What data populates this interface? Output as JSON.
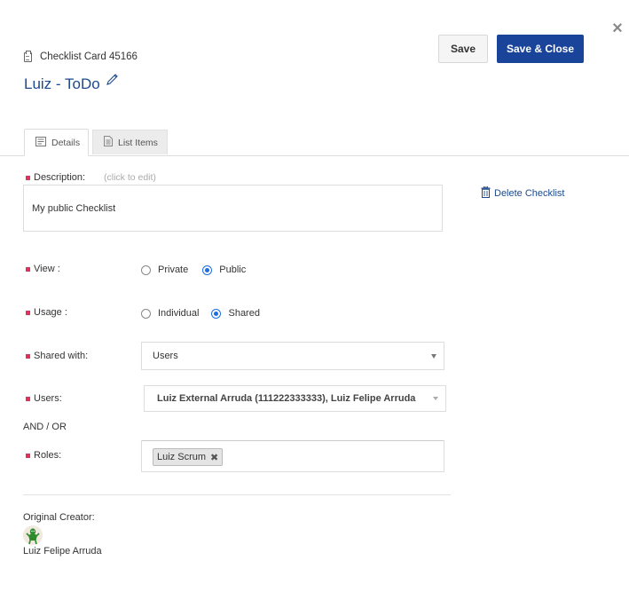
{
  "header": {
    "card_label": "Checklist Card 45166",
    "title": "Luiz - ToDo",
    "save_label": "Save",
    "save_close_label": "Save & Close",
    "close_glyph": "×"
  },
  "tabs": [
    {
      "label": "Details",
      "active": true,
      "icon": "document-icon"
    },
    {
      "label": "List Items",
      "active": false,
      "icon": "list-document-icon"
    }
  ],
  "details": {
    "description_label": "Description:",
    "description_hint": "(click to edit)",
    "description_value": "My public Checklist",
    "delete_label": "Delete Checklist",
    "view": {
      "label": "View :",
      "options": [
        "Private",
        "Public"
      ],
      "selected": "Public"
    },
    "usage": {
      "label": "Usage :",
      "options": [
        "Individual",
        "Shared"
      ],
      "selected": "Shared"
    },
    "shared_with": {
      "label": "Shared with:",
      "value": "Users"
    },
    "users": {
      "label": "Users:",
      "value": "Luiz External Arruda (111222333333), Luiz Felipe Arruda"
    },
    "and_or_label": "AND / OR",
    "roles": {
      "label": "Roles:",
      "chips": [
        "Luiz Scrum"
      ]
    },
    "creator": {
      "label": "Original Creator:",
      "name": "Luiz Felipe Arruda"
    }
  },
  "colors": {
    "primary": "#1a4499",
    "title": "#1c4a8e",
    "required": "#e0315c",
    "radio_selected": "#1e6ee0"
  }
}
